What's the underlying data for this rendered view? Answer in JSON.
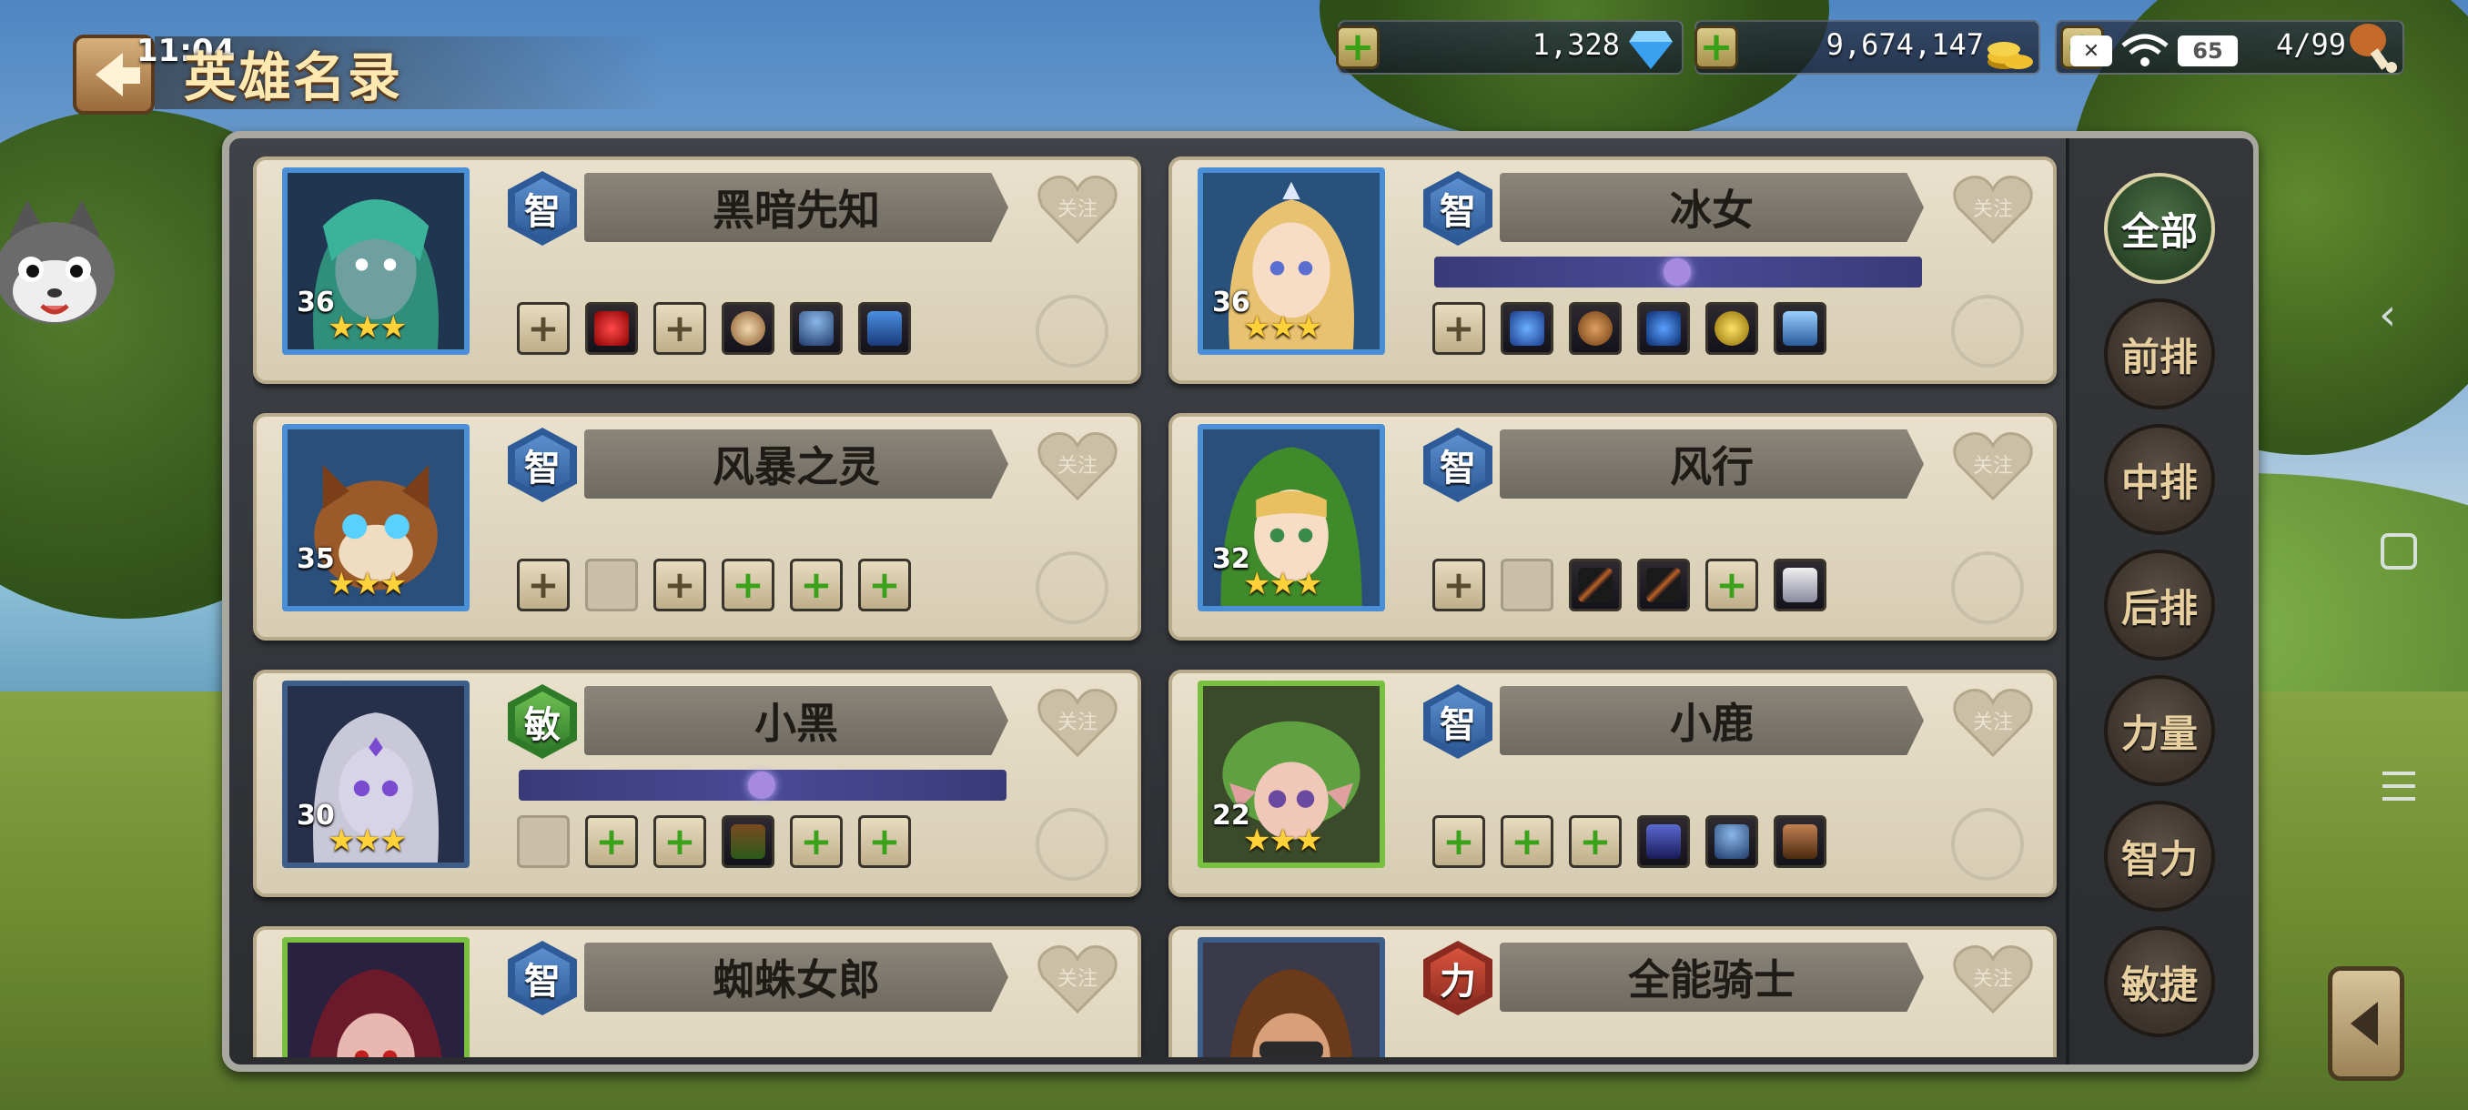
{
  "status": {
    "time": "11:04"
  },
  "header": {
    "title": "英雄名录"
  },
  "resources": {
    "gems": "1,328",
    "gold": "9,674,147",
    "battery": "65",
    "stamina": "4/99"
  },
  "tabs": [
    {
      "label": "全部",
      "active": true
    },
    {
      "label": "前排",
      "active": false
    },
    {
      "label": "中排",
      "active": false
    },
    {
      "label": "后排",
      "active": false
    },
    {
      "label": "力量",
      "active": false
    },
    {
      "label": "智力",
      "active": false
    },
    {
      "label": "敏捷",
      "active": false
    }
  ],
  "follow_label": "关注",
  "heroes": [
    {
      "name": "黑暗先知",
      "attr": "智",
      "level": "36",
      "stars": 3
    },
    {
      "name": "冰女",
      "attr": "智",
      "level": "36",
      "stars": 3
    },
    {
      "name": "风暴之灵",
      "attr": "智",
      "level": "35",
      "stars": 3
    },
    {
      "name": "风行",
      "attr": "智",
      "level": "32",
      "stars": 3
    },
    {
      "name": "小黑",
      "attr": "敏",
      "level": "30",
      "stars": 3
    },
    {
      "name": "小鹿",
      "attr": "智",
      "level": "22",
      "stars": 3
    },
    {
      "name": "蜘蛛女郎",
      "attr": "智",
      "level": "",
      "stars": 0
    },
    {
      "name": "全能骑士",
      "attr": "力",
      "level": "",
      "stars": 0
    }
  ],
  "star_glyphs": "★★★",
  "colors": {
    "accent": "#ffd23a",
    "int": "#2e5b98",
    "agi": "#2f7a29",
    "str": "#8a2a20"
  }
}
